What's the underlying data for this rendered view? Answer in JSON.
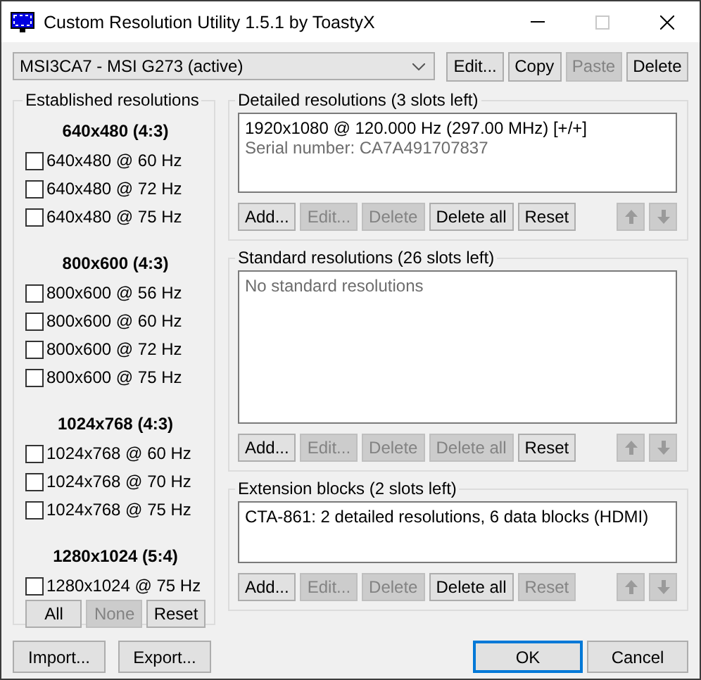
{
  "window": {
    "title": "Custom Resolution Utility 1.5.1 by ToastyX"
  },
  "device_select": {
    "value": "MSI3CA7 - MSI G273 (active)"
  },
  "device_buttons": [
    {
      "label": "Edit...",
      "disabled": false
    },
    {
      "label": "Copy",
      "disabled": false
    },
    {
      "label": "Paste",
      "disabled": true
    },
    {
      "label": "Delete",
      "disabled": false
    }
  ],
  "established": {
    "title": "Established resolutions",
    "groups": [
      {
        "heading": "640x480 (4:3)",
        "items": [
          {
            "label": "640x480 @ 60 Hz",
            "checked": false
          },
          {
            "label": "640x480 @ 72 Hz",
            "checked": false
          },
          {
            "label": "640x480 @ 75 Hz",
            "checked": false
          }
        ]
      },
      {
        "heading": "800x600 (4:3)",
        "items": [
          {
            "label": "800x600 @ 56 Hz",
            "checked": false
          },
          {
            "label": "800x600 @ 60 Hz",
            "checked": false
          },
          {
            "label": "800x600 @ 72 Hz",
            "checked": false
          },
          {
            "label": "800x600 @ 75 Hz",
            "checked": false
          }
        ]
      },
      {
        "heading": "1024x768 (4:3)",
        "items": [
          {
            "label": "1024x768 @ 60 Hz",
            "checked": false
          },
          {
            "label": "1024x768 @ 70 Hz",
            "checked": false
          },
          {
            "label": "1024x768 @ 75 Hz",
            "checked": false
          }
        ]
      },
      {
        "heading": "1280x1024 (5:4)",
        "items": [
          {
            "label": "1280x1024 @ 75 Hz",
            "checked": false
          }
        ]
      }
    ],
    "buttons": [
      {
        "label": "All",
        "disabled": false
      },
      {
        "label": "None",
        "disabled": true
      },
      {
        "label": "Reset",
        "disabled": false
      }
    ]
  },
  "sections": [
    {
      "title": "Detailed resolutions (3 slots left)",
      "items": [
        {
          "text": "1920x1080 @ 120.000 Hz (297.00 MHz) [+/+]",
          "kind": "entry"
        },
        {
          "text": "Serial number: CA7A491707837",
          "kind": "note"
        }
      ],
      "buttons": [
        {
          "label": "Add...",
          "disabled": false
        },
        {
          "label": "Edit...",
          "disabled": true
        },
        {
          "label": "Delete",
          "disabled": true
        },
        {
          "label": "Delete all",
          "disabled": false
        },
        {
          "label": "Reset",
          "disabled": false
        }
      ],
      "move_buttons": [
        {
          "kind": "up",
          "disabled": true
        },
        {
          "kind": "down",
          "disabled": true
        }
      ]
    },
    {
      "title": "Standard resolutions (26 slots left)",
      "empty_text": "No standard resolutions",
      "buttons": [
        {
          "label": "Add...",
          "disabled": false
        },
        {
          "label": "Edit...",
          "disabled": true
        },
        {
          "label": "Delete",
          "disabled": true
        },
        {
          "label": "Delete all",
          "disabled": true
        },
        {
          "label": "Reset",
          "disabled": false
        }
      ],
      "move_buttons": [
        {
          "kind": "up",
          "disabled": true
        },
        {
          "kind": "down",
          "disabled": true
        }
      ]
    },
    {
      "title": "Extension blocks (2 slots left)",
      "items": [
        {
          "text": "CTA-861: 2 detailed resolutions, 6 data blocks (HDMI)",
          "kind": "entry"
        }
      ],
      "buttons": [
        {
          "label": "Add...",
          "disabled": false
        },
        {
          "label": "Edit...",
          "disabled": true
        },
        {
          "label": "Delete",
          "disabled": true
        },
        {
          "label": "Delete all",
          "disabled": false
        },
        {
          "label": "Reset",
          "disabled": true
        }
      ],
      "move_buttons": [
        {
          "kind": "up",
          "disabled": true
        },
        {
          "kind": "down",
          "disabled": true
        }
      ]
    }
  ],
  "file_buttons": [
    {
      "label": "Import...",
      "disabled": false
    },
    {
      "label": "Export...",
      "disabled": false
    }
  ],
  "dialog_buttons": [
    {
      "label": "OK",
      "default": true
    },
    {
      "label": "Cancel",
      "default": false
    }
  ]
}
